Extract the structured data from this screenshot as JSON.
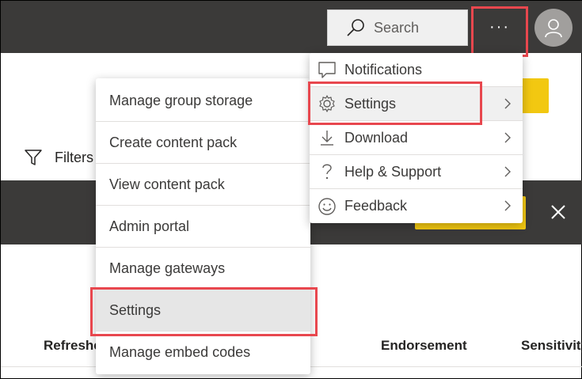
{
  "topbar": {
    "search_label": "Search",
    "more_label": "···"
  },
  "toolbar": {
    "filters_label": "Filters"
  },
  "table": {
    "columns": [
      "Refreshed",
      "Endorsement",
      "Sensitivity"
    ]
  },
  "more_menu": {
    "items": [
      {
        "label": "Notifications",
        "icon": "notification-icon",
        "has_submenu": false
      },
      {
        "label": "Settings",
        "icon": "gear-icon",
        "has_submenu": true
      },
      {
        "label": "Download",
        "icon": "download-icon",
        "has_submenu": true
      },
      {
        "label": "Help & Support",
        "icon": "help-icon",
        "has_submenu": true
      },
      {
        "label": "Feedback",
        "icon": "smiley-icon",
        "has_submenu": true
      }
    ]
  },
  "settings_submenu": {
    "items": [
      {
        "label": "Manage group storage"
      },
      {
        "label": "Create content pack"
      },
      {
        "label": "View content pack"
      },
      {
        "label": "Admin portal"
      },
      {
        "label": "Manage gateways"
      },
      {
        "label": "Settings"
      },
      {
        "label": "Manage embed codes"
      }
    ]
  },
  "colors": {
    "header_bg": "#3b3a39",
    "accent_yellow": "#f2c811",
    "highlight_red": "#e8474e"
  }
}
